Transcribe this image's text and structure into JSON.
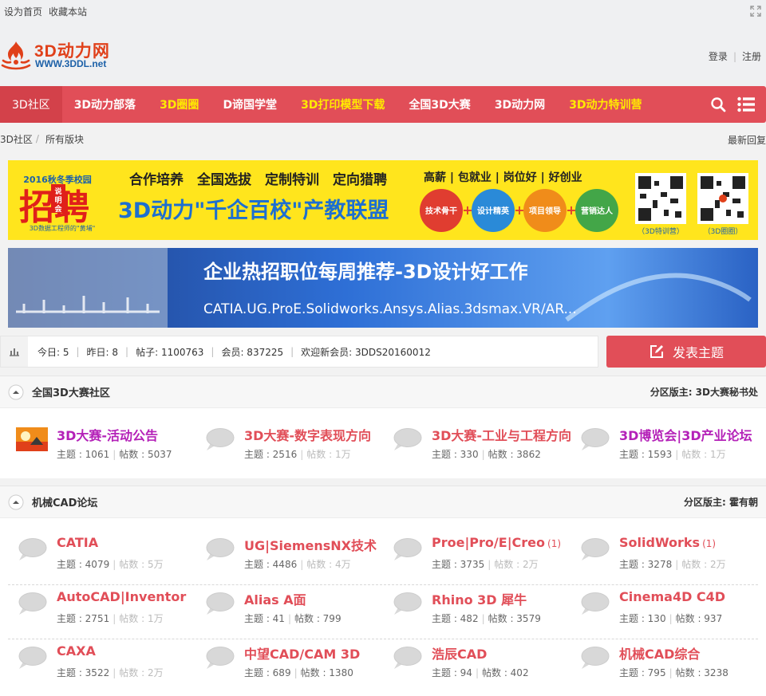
{
  "topbar": {
    "set_home": "设为首页",
    "bookmark": "收藏本站"
  },
  "logo": {
    "main": "3D动力网",
    "sub": "WWW.3DDL.net"
  },
  "auth": {
    "login": "登录",
    "register": "注册"
  },
  "nav": [
    {
      "label": "3D社区",
      "active": true,
      "yellow": false
    },
    {
      "label": "3D动力部落",
      "active": false,
      "yellow": false
    },
    {
      "label": "3D圈圈",
      "active": false,
      "yellow": true
    },
    {
      "label": "D谛国学堂",
      "active": false,
      "yellow": false
    },
    {
      "label": "3D打印模型下载",
      "active": false,
      "yellow": true
    },
    {
      "label": "全国3D大赛",
      "active": false,
      "yellow": false
    },
    {
      "label": "3D动力网",
      "active": false,
      "yellow": false
    },
    {
      "label": "3D动力特训营",
      "active": false,
      "yellow": true
    }
  ],
  "breadcrumb": {
    "home": "3D社区",
    "current": "所有版块",
    "latest": "最新回复"
  },
  "banner1": {
    "left_title": "招聘",
    "left_small": "2016秋冬季校园",
    "left_tag": "说明会",
    "left_sub": "3D数据工程师的\"黄埔\"",
    "slogans": "合作培养　全国选拔　定制特训　定向猎聘",
    "main": "3D动力\"千企百校\"产教联盟",
    "perks": "高薪 | 包就业 | 岗位好 | 好创业",
    "circles": [
      "技术骨干",
      "设计精英",
      "项目领导",
      "营销达人"
    ],
    "qr1": "（3D特训营）",
    "qr2": "（3D圈圈）"
  },
  "banner2": {
    "title": "企业热招职位每周推荐-3D设计好工作",
    "sub": "CATIA.UG.ProE.Solidworks.Ansys.Alias.3dsmax.VR/AR..."
  },
  "stats": {
    "today": "今日: 5",
    "yesterday": "昨日: 8",
    "posts": "帖子: 1100763",
    "members": "会员: 837225",
    "welcome": "欢迎新会员: 3DDS20160012"
  },
  "post_button": "发表主题",
  "colors": {
    "accent": "#e14e58",
    "purple": "#b421b8",
    "yellow": "#ffea00"
  },
  "sections": [
    {
      "title": "全国3D大赛社区",
      "moderator": "分区版主: 3D大赛秘书处",
      "rows": [
        [
          {
            "name": "3D大赛-活动公告",
            "new": "",
            "topics": "主题 : 1061",
            "posts": "帖数 : 5037",
            "posts_grey": false,
            "purple": true,
            "icon": "forum-image-icon"
          },
          {
            "name": "3D大赛-数字表现方向",
            "new": "",
            "topics": "主题 : 2516",
            "posts": "帖数 : 1万",
            "posts_grey": true,
            "purple": false,
            "icon": "speech-bubble-icon"
          },
          {
            "name": "3D大赛-工业与工程方向",
            "new": "",
            "topics": "主题 : 330",
            "posts": "帖数 : 3862",
            "posts_grey": false,
            "purple": false,
            "icon": "speech-bubble-icon"
          },
          {
            "name": "3D博览会|3D产业论坛",
            "new": "",
            "topics": "主题 : 1593",
            "posts": "帖数 : 1万",
            "posts_grey": true,
            "purple": true,
            "icon": "speech-bubble-icon"
          }
        ]
      ]
    },
    {
      "title": "机械CAD论坛",
      "moderator": "分区版主: 霍有朝",
      "rows": [
        [
          {
            "name": "CATIA",
            "new": "",
            "topics": "主题 : 4079",
            "posts": "帖数 : 5万",
            "posts_grey": true,
            "purple": false,
            "icon": "speech-bubble-icon"
          },
          {
            "name": "UG|SiemensNX技术",
            "new": "",
            "topics": "主题 : 4486",
            "posts": "帖数 : 4万",
            "posts_grey": true,
            "purple": false,
            "icon": "speech-bubble-icon"
          },
          {
            "name": "Proe|Pro/E|Creo",
            "new": "(1)",
            "topics": "主题 : 3735",
            "posts": "帖数 : 2万",
            "posts_grey": true,
            "purple": false,
            "icon": "speech-bubble-icon"
          },
          {
            "name": "SolidWorks",
            "new": "(1)",
            "topics": "主题 : 3278",
            "posts": "帖数 : 2万",
            "posts_grey": true,
            "purple": false,
            "icon": "speech-bubble-icon"
          }
        ],
        [
          {
            "name": "AutoCAD|Inventor",
            "new": "",
            "topics": "主题 : 2751",
            "posts": "帖数 : 1万",
            "posts_grey": true,
            "purple": false,
            "icon": "speech-bubble-icon"
          },
          {
            "name": "Alias A面",
            "new": "",
            "topics": "主题 : 41",
            "posts": "帖数 : 799",
            "posts_grey": false,
            "purple": false,
            "icon": "speech-bubble-icon"
          },
          {
            "name": "Rhino 3D 犀牛",
            "new": "",
            "topics": "主题 : 482",
            "posts": "帖数 : 3579",
            "posts_grey": false,
            "purple": false,
            "icon": "speech-bubble-icon"
          },
          {
            "name": "Cinema4D C4D",
            "new": "",
            "topics": "主题 : 130",
            "posts": "帖数 : 937",
            "posts_grey": false,
            "purple": false,
            "icon": "speech-bubble-icon"
          }
        ],
        [
          {
            "name": "CAXA",
            "new": "",
            "topics": "主题 : 3522",
            "posts": "帖数 : 2万",
            "posts_grey": true,
            "purple": false,
            "icon": "speech-bubble-icon"
          },
          {
            "name": "中望CAD/CAM 3D",
            "new": "",
            "topics": "主题 : 689",
            "posts": "帖数 : 1380",
            "posts_grey": false,
            "purple": false,
            "icon": "speech-bubble-icon"
          },
          {
            "name": "浩辰CAD",
            "new": "",
            "topics": "主题 : 94",
            "posts": "帖数 : 402",
            "posts_grey": false,
            "purple": false,
            "icon": "speech-bubble-icon"
          },
          {
            "name": "机械CAD综合",
            "new": "",
            "topics": "主题 : 795",
            "posts": "帖数 : 3238",
            "posts_grey": false,
            "purple": false,
            "icon": "speech-bubble-icon"
          }
        ]
      ]
    }
  ]
}
